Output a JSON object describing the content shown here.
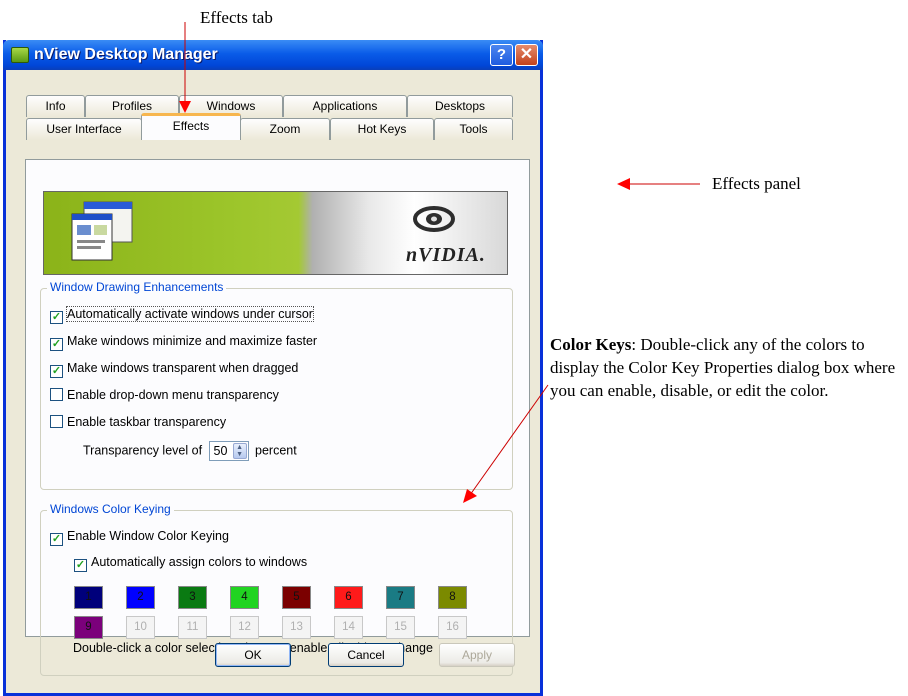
{
  "annotations": {
    "effects_tab": "Effects tab",
    "effects_panel": "Effects panel",
    "color_keys_title": "Color Keys",
    "color_keys_body": ": Double-click any of the colors to display the Color Key Properties dialog box where you can enable, disable, or edit the color."
  },
  "window": {
    "title": "nView Desktop Manager",
    "help_glyph": "?",
    "close_glyph": "✕"
  },
  "tabs": {
    "row1": [
      "Info",
      "Profiles",
      "Windows",
      "Applications",
      "Desktops"
    ],
    "row2": [
      "User Interface",
      "Effects",
      "Zoom",
      "Hot Keys",
      "Tools"
    ],
    "active": "Effects"
  },
  "banner": {
    "logo_text": "nVIDIA."
  },
  "drawing": {
    "legend": "Window Drawing Enhancements",
    "options": [
      {
        "label": "Automatically activate windows under cursor",
        "checked": true
      },
      {
        "label": "Make windows minimize and maximize faster",
        "checked": true
      },
      {
        "label": "Make windows transparent when dragged",
        "checked": true
      },
      {
        "label": "Enable drop-down menu transparency",
        "checked": false
      },
      {
        "label": "Enable taskbar transparency",
        "checked": false
      }
    ],
    "transparency_prefix": "Transparency level of",
    "transparency_value": "50",
    "transparency_suffix": "percent"
  },
  "keying": {
    "legend": "Windows Color Keying",
    "enable_label": "Enable Window Color Keying",
    "enable_checked": true,
    "auto_label": "Automatically assign colors to windows",
    "auto_checked": true,
    "swatches": [
      {
        "n": "1",
        "color": "#00007b"
      },
      {
        "n": "2",
        "color": "#0000ff"
      },
      {
        "n": "3",
        "color": "#0a7a12"
      },
      {
        "n": "4",
        "color": "#21d421"
      },
      {
        "n": "5",
        "color": "#7b0000"
      },
      {
        "n": "6",
        "color": "#ff1a1a"
      },
      {
        "n": "7",
        "color": "#1a7b84"
      },
      {
        "n": "8",
        "color": "#7b8a00"
      },
      {
        "n": "9",
        "color": "#7b007b"
      },
      {
        "n": "10",
        "color": ""
      },
      {
        "n": "11",
        "color": ""
      },
      {
        "n": "12",
        "color": ""
      },
      {
        "n": "13",
        "color": ""
      },
      {
        "n": "14",
        "color": ""
      },
      {
        "n": "15",
        "color": ""
      },
      {
        "n": "16",
        "color": ""
      }
    ],
    "note": "Double-click a color selection above to enable, disable or change"
  },
  "buttons": {
    "ok": "OK",
    "cancel": "Cancel",
    "apply": "Apply"
  }
}
